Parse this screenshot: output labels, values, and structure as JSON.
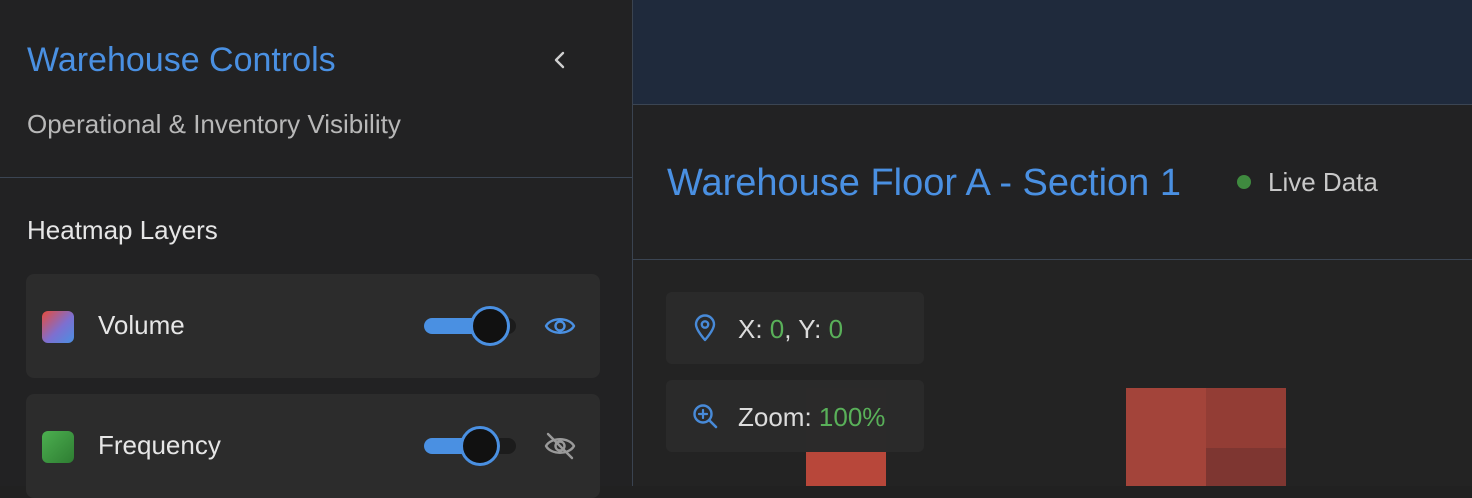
{
  "sidebar": {
    "title": "Warehouse Controls",
    "subtitle": "Operational & Inventory Visibility",
    "collapse_icon": "chevron-left-icon",
    "section_title": "Heatmap Layers",
    "layers": [
      {
        "label": "Volume",
        "slider_fraction": 0.72,
        "visible": true,
        "visibility_icon": "eye-icon"
      },
      {
        "label": "Frequency",
        "slider_fraction": 0.6,
        "visible": false,
        "visibility_icon": "eye-off-icon"
      }
    ]
  },
  "main": {
    "title": "Warehouse Floor A - Section 1",
    "status": {
      "label": "Live Data",
      "color": "#3f8a3f"
    },
    "coords": {
      "x_label": "X: ",
      "x_value": "0",
      "sep": ", Y: ",
      "y_value": "0",
      "icon": "map-pin-icon"
    },
    "zoom": {
      "label": "Zoom: ",
      "value": "100%",
      "icon": "zoom-in-icon"
    }
  },
  "colors": {
    "accent": "#4a90e2",
    "value_green": "#5cb85c",
    "heat_high": "#b8473a",
    "heat_mid": "#a3443a",
    "heat_low": "#8a3a33"
  }
}
